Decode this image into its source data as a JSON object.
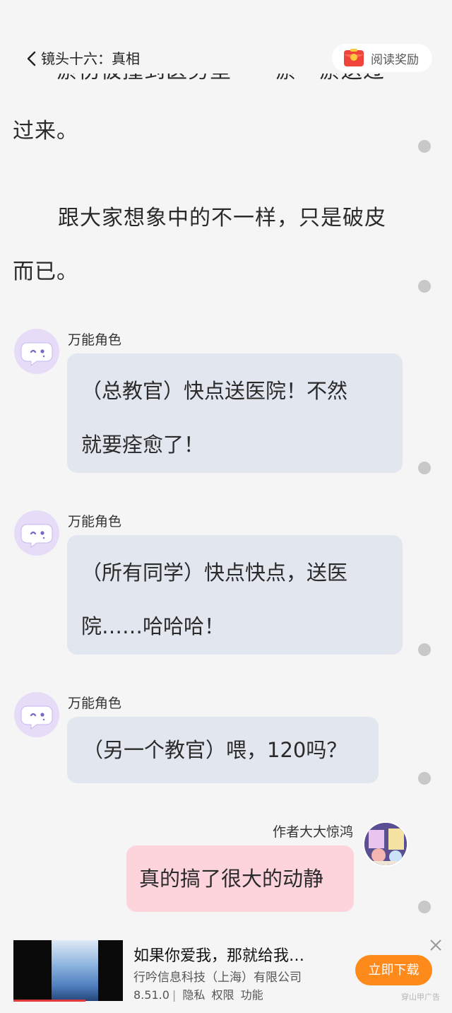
{
  "header": {
    "chapter_title": "镜头十六：真相",
    "reward_label": "阅读奖励"
  },
  "story": {
    "partial_line": "瘀伤被撞到医务室——瘀一瘀送过",
    "para1_end": "过来。",
    "para2_line1": "跟大家想象中的不一样，只是破皮",
    "para2_line2": "而已。"
  },
  "messages": [
    {
      "speaker": "万能角色",
      "line1": "（总教官）快点送医院！不然",
      "line2": "就要痊愈了！"
    },
    {
      "speaker": "万能角色",
      "line1": "（所有同学）快点快点，送医",
      "line2": "院……哈哈哈！"
    },
    {
      "speaker": "万能角色",
      "line1": "（另一个教官）喂，120吗？"
    }
  ],
  "author_message": {
    "name": "作者大大惊鸿",
    "text": "真的搞了很大的动静"
  },
  "ad": {
    "title": "如果你爱我，那就给我…",
    "company": "行吟信息科技（上海）有限公司",
    "version": "8.51.0",
    "privacy": "隐私",
    "permissions": "权限",
    "features": "功能",
    "download_label": "立即下载",
    "brand": "穿山甲广告"
  },
  "colors": {
    "background": "#f5f5f5",
    "bubble": "#e2e6ef",
    "author_bubble": "#fdd4dc",
    "avatar": "#e6dcf8",
    "download": "#ff8a1c"
  },
  "icons": [
    "chevron-left-icon",
    "red-envelope-icon",
    "chat-bubble-face-icon",
    "close-icon"
  ]
}
